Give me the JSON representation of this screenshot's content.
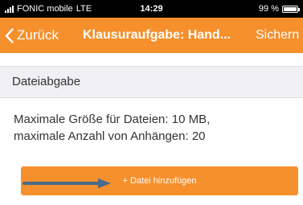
{
  "status_bar": {
    "carrier": "FONIC mobile",
    "network": "LTE",
    "time": "14:29",
    "battery": "99 %",
    "battery_level": 0.99
  },
  "nav": {
    "back_label": "Zurück",
    "title": "Klausuraufgabe: Hand...",
    "action_label": "Sichern"
  },
  "section": {
    "title": "Dateiabgabe"
  },
  "info": {
    "line1": "Maximale Größe für Dateien: 10 MB,",
    "line2": "maximale Anzahl von Anhängen: 20"
  },
  "add_button": {
    "label": "+ Datei hinzufügen"
  },
  "colors": {
    "accent": "#f5902c",
    "section_bg": "#efeff4",
    "arrow": "#4a6b8a"
  }
}
